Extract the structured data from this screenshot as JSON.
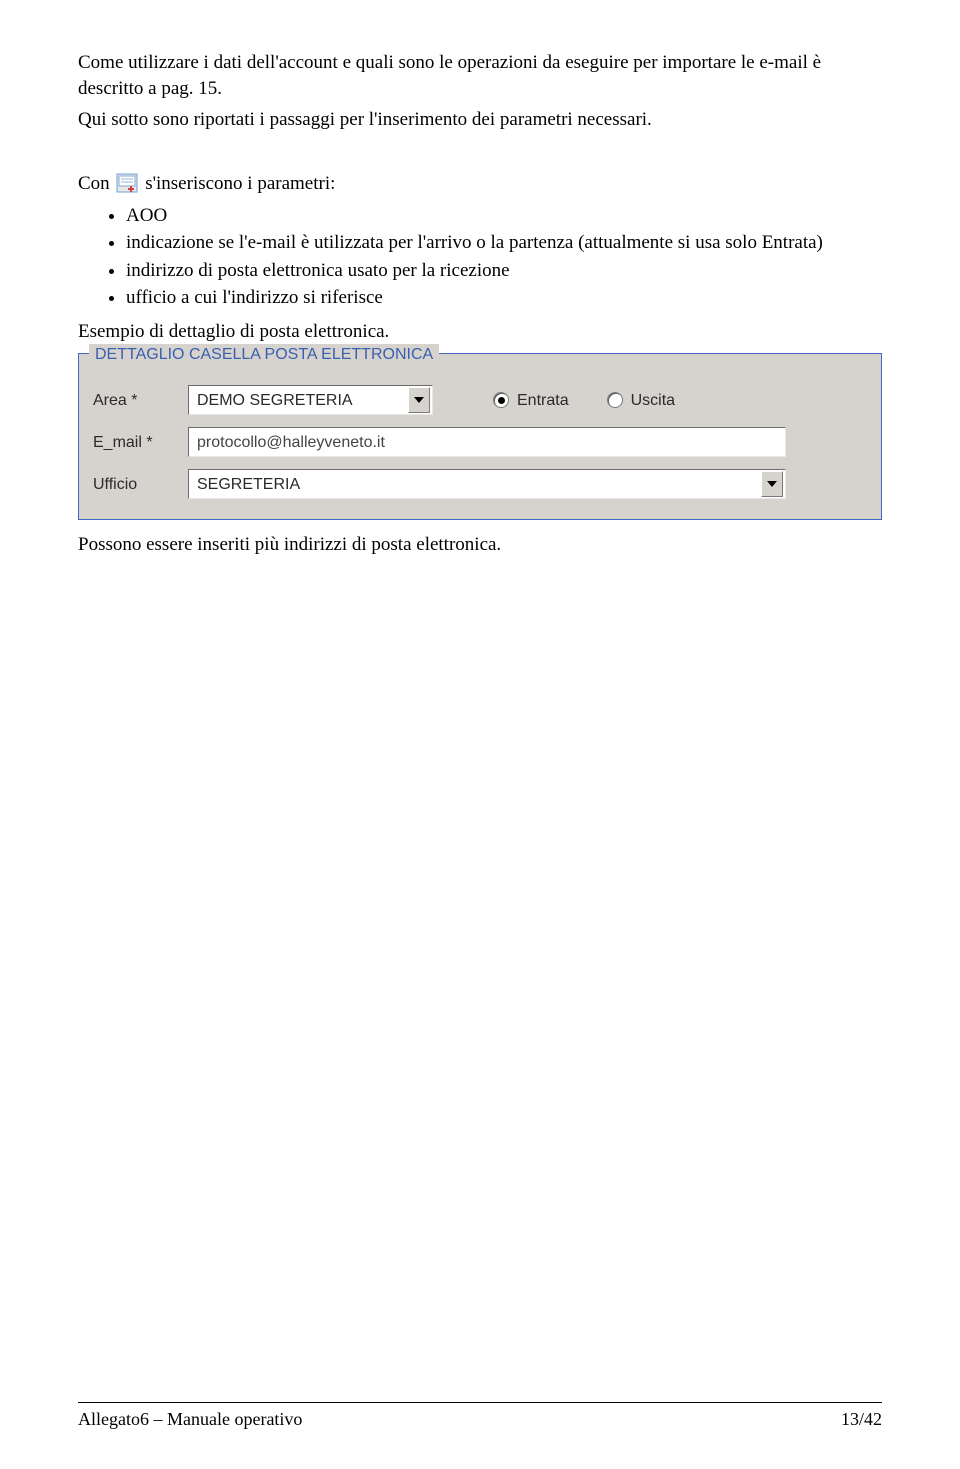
{
  "para1_a": "Come utilizzare i dati dell'account e quali sono le operazioni da eseguire per importare le e-mail è descritto a pag. 15.",
  "para1_b": "Qui sotto sono riportati i passaggi per l'inserimento dei parametri necessari.",
  "para2_prefix": "Con",
  "para2_suffix": " s'inseriscono i parametri:",
  "bullets": {
    "b1": "AOO",
    "b2": "indicazione se l'e-mail è utilizzata per l'arrivo o la partenza (attualmente si usa solo Entrata)",
    "b3": "indirizzo di posta elettronica usato per la ricezione",
    "b4": "ufficio a cui l'indirizzo si riferisce"
  },
  "para3": "Esempio di dettaglio di posta elettronica.",
  "panel": {
    "title": "DETTAGLIO CASELLA POSTA ELETTRONICA",
    "area_label": "Area *",
    "area_value": "DEMO SEGRETERIA",
    "radio_entrata": "Entrata",
    "radio_uscita": "Uscita",
    "email_label": "E_mail *",
    "email_value": "protocollo@halleyveneto.it",
    "ufficio_label": "Ufficio",
    "ufficio_value": "SEGRETERIA"
  },
  "para4": "Possono essere inseriti più indirizzi di posta elettronica.",
  "footer_left": "Allegato6 – Manuale operativo",
  "footer_right": "13/42"
}
